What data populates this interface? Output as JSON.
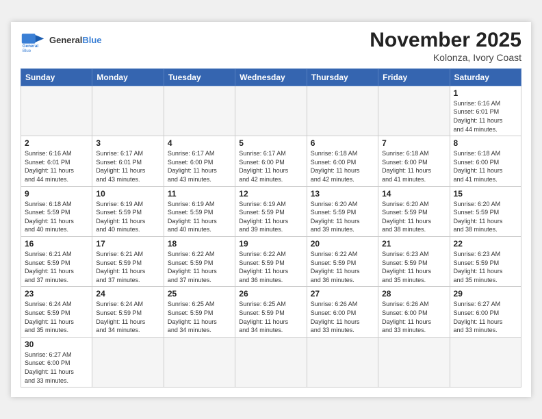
{
  "header": {
    "logo_general": "General",
    "logo_blue": "Blue",
    "month_title": "November 2025",
    "location": "Kolonza, Ivory Coast"
  },
  "days_of_week": [
    "Sunday",
    "Monday",
    "Tuesday",
    "Wednesday",
    "Thursday",
    "Friday",
    "Saturday"
  ],
  "weeks": [
    [
      {
        "day": "",
        "info": ""
      },
      {
        "day": "",
        "info": ""
      },
      {
        "day": "",
        "info": ""
      },
      {
        "day": "",
        "info": ""
      },
      {
        "day": "",
        "info": ""
      },
      {
        "day": "",
        "info": ""
      },
      {
        "day": "1",
        "info": "Sunrise: 6:16 AM\nSunset: 6:01 PM\nDaylight: 11 hours\nand 44 minutes."
      }
    ],
    [
      {
        "day": "2",
        "info": "Sunrise: 6:16 AM\nSunset: 6:01 PM\nDaylight: 11 hours\nand 44 minutes."
      },
      {
        "day": "3",
        "info": "Sunrise: 6:17 AM\nSunset: 6:01 PM\nDaylight: 11 hours\nand 43 minutes."
      },
      {
        "day": "4",
        "info": "Sunrise: 6:17 AM\nSunset: 6:00 PM\nDaylight: 11 hours\nand 43 minutes."
      },
      {
        "day": "5",
        "info": "Sunrise: 6:17 AM\nSunset: 6:00 PM\nDaylight: 11 hours\nand 42 minutes."
      },
      {
        "day": "6",
        "info": "Sunrise: 6:18 AM\nSunset: 6:00 PM\nDaylight: 11 hours\nand 42 minutes."
      },
      {
        "day": "7",
        "info": "Sunrise: 6:18 AM\nSunset: 6:00 PM\nDaylight: 11 hours\nand 41 minutes."
      },
      {
        "day": "8",
        "info": "Sunrise: 6:18 AM\nSunset: 6:00 PM\nDaylight: 11 hours\nand 41 minutes."
      }
    ],
    [
      {
        "day": "9",
        "info": "Sunrise: 6:18 AM\nSunset: 5:59 PM\nDaylight: 11 hours\nand 40 minutes."
      },
      {
        "day": "10",
        "info": "Sunrise: 6:19 AM\nSunset: 5:59 PM\nDaylight: 11 hours\nand 40 minutes."
      },
      {
        "day": "11",
        "info": "Sunrise: 6:19 AM\nSunset: 5:59 PM\nDaylight: 11 hours\nand 40 minutes."
      },
      {
        "day": "12",
        "info": "Sunrise: 6:19 AM\nSunset: 5:59 PM\nDaylight: 11 hours\nand 39 minutes."
      },
      {
        "day": "13",
        "info": "Sunrise: 6:20 AM\nSunset: 5:59 PM\nDaylight: 11 hours\nand 39 minutes."
      },
      {
        "day": "14",
        "info": "Sunrise: 6:20 AM\nSunset: 5:59 PM\nDaylight: 11 hours\nand 38 minutes."
      },
      {
        "day": "15",
        "info": "Sunrise: 6:20 AM\nSunset: 5:59 PM\nDaylight: 11 hours\nand 38 minutes."
      }
    ],
    [
      {
        "day": "16",
        "info": "Sunrise: 6:21 AM\nSunset: 5:59 PM\nDaylight: 11 hours\nand 37 minutes."
      },
      {
        "day": "17",
        "info": "Sunrise: 6:21 AM\nSunset: 5:59 PM\nDaylight: 11 hours\nand 37 minutes."
      },
      {
        "day": "18",
        "info": "Sunrise: 6:22 AM\nSunset: 5:59 PM\nDaylight: 11 hours\nand 37 minutes."
      },
      {
        "day": "19",
        "info": "Sunrise: 6:22 AM\nSunset: 5:59 PM\nDaylight: 11 hours\nand 36 minutes."
      },
      {
        "day": "20",
        "info": "Sunrise: 6:22 AM\nSunset: 5:59 PM\nDaylight: 11 hours\nand 36 minutes."
      },
      {
        "day": "21",
        "info": "Sunrise: 6:23 AM\nSunset: 5:59 PM\nDaylight: 11 hours\nand 35 minutes."
      },
      {
        "day": "22",
        "info": "Sunrise: 6:23 AM\nSunset: 5:59 PM\nDaylight: 11 hours\nand 35 minutes."
      }
    ],
    [
      {
        "day": "23",
        "info": "Sunrise: 6:24 AM\nSunset: 5:59 PM\nDaylight: 11 hours\nand 35 minutes."
      },
      {
        "day": "24",
        "info": "Sunrise: 6:24 AM\nSunset: 5:59 PM\nDaylight: 11 hours\nand 34 minutes."
      },
      {
        "day": "25",
        "info": "Sunrise: 6:25 AM\nSunset: 5:59 PM\nDaylight: 11 hours\nand 34 minutes."
      },
      {
        "day": "26",
        "info": "Sunrise: 6:25 AM\nSunset: 5:59 PM\nDaylight: 11 hours\nand 34 minutes."
      },
      {
        "day": "27",
        "info": "Sunrise: 6:26 AM\nSunset: 6:00 PM\nDaylight: 11 hours\nand 33 minutes."
      },
      {
        "day": "28",
        "info": "Sunrise: 6:26 AM\nSunset: 6:00 PM\nDaylight: 11 hours\nand 33 minutes."
      },
      {
        "day": "29",
        "info": "Sunrise: 6:27 AM\nSunset: 6:00 PM\nDaylight: 11 hours\nand 33 minutes."
      }
    ],
    [
      {
        "day": "30",
        "info": "Sunrise: 6:27 AM\nSunset: 6:00 PM\nDaylight: 11 hours\nand 33 minutes."
      },
      {
        "day": "",
        "info": ""
      },
      {
        "day": "",
        "info": ""
      },
      {
        "day": "",
        "info": ""
      },
      {
        "day": "",
        "info": ""
      },
      {
        "day": "",
        "info": ""
      },
      {
        "day": "",
        "info": ""
      }
    ]
  ]
}
